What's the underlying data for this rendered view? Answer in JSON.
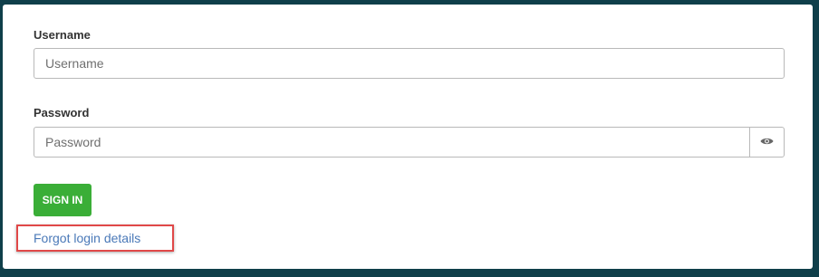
{
  "form": {
    "username": {
      "label": "Username",
      "placeholder": "Username",
      "value": ""
    },
    "password": {
      "label": "Password",
      "placeholder": "Password",
      "value": "",
      "toggle_icon": "eye-icon"
    },
    "submit_label": "SIGN IN",
    "forgot_link": "Forgot login details"
  },
  "colors": {
    "background": "#0f3f4a",
    "button": "#3aae37",
    "link": "#4a79b8",
    "highlight": "#e04848"
  }
}
